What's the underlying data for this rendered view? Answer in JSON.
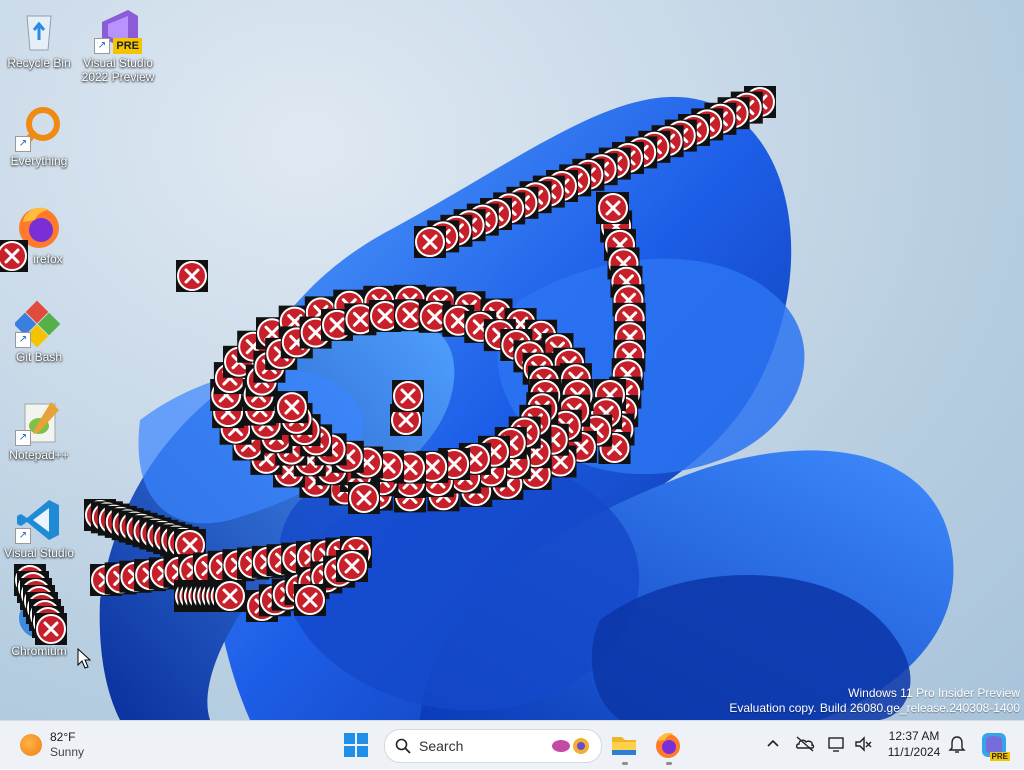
{
  "desktop": {
    "icons": [
      {
        "label": "Recycle Bin",
        "icon": "recycle-bin-icon"
      },
      {
        "label": "Visual Studio 2022 Preview",
        "badge": "PRE",
        "icon": "visual-studio-preview-icon"
      },
      {
        "label": "Everything",
        "icon": "everything-search-icon"
      },
      {
        "label": "irefox",
        "icon": "firefox-icon"
      },
      {
        "label": "Git Bash",
        "icon": "git-bash-icon"
      },
      {
        "label": "Notepad++",
        "icon": "notepad-plus-plus-icon"
      },
      {
        "label": "Visual Studio",
        "icon": "vscode-icon"
      },
      {
        "label": "Chromium",
        "icon": "chromium-icon"
      }
    ],
    "watermark": {
      "line1": "Windows 11 Pro Insider Preview",
      "line2": "Evaluation copy. Build 26080.ge_release.240308-1400"
    }
  },
  "error_icon": "error-x-icon",
  "taskbar": {
    "weather": {
      "temperature": "82°F",
      "condition": "Sunny",
      "icon": "sun-icon"
    },
    "start_icon": "windows-start-icon",
    "search_label": "Search",
    "pinned": [
      {
        "name": "File Explorer",
        "icon": "file-explorer-icon",
        "running": true
      },
      {
        "name": "Firefox",
        "icon": "firefox-icon",
        "running": true
      }
    ],
    "tray": {
      "chevron_icon": "chevron-up-icon",
      "onedrive_icon": "onedrive-icon",
      "network_icon": "network-icon",
      "volume_icon": "volume-icon",
      "time": "12:37 AM",
      "date": "11/1/2024",
      "notification_icon": "bell-icon",
      "copilot_badge": "PRE"
    }
  },
  "colors": {
    "error_red": "#c8202b",
    "wallpaper_blue": "#1f5fe0",
    "taskbar_bg": "#eef2f7"
  }
}
